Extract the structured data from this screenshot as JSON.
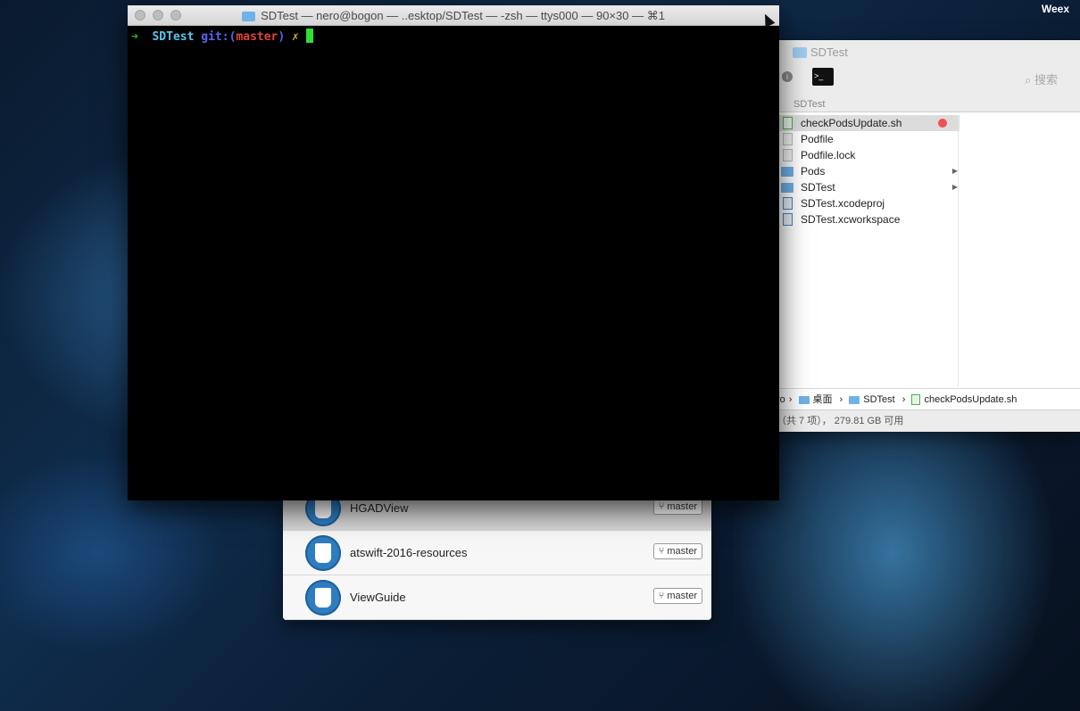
{
  "menubar": {
    "app_name": "Weex"
  },
  "github_desktop": {
    "repos": [
      {
        "name": "HGADView",
        "branch": "master",
        "selected": true
      },
      {
        "name": "atswift-2016-resources",
        "branch": "master",
        "selected": false
      },
      {
        "name": "ViewGuide",
        "branch": "master",
        "selected": false
      }
    ]
  },
  "finder": {
    "title": "SDTest",
    "search_label": "搜索",
    "path_header": "SDTest",
    "terminal_button_label": ">_",
    "files": [
      {
        "name": "checkPodsUpdate.sh",
        "kind": "script",
        "tag_color": "#ee5050",
        "selected": true
      },
      {
        "name": "Podfile",
        "kind": "file"
      },
      {
        "name": "Podfile.lock",
        "kind": "file"
      },
      {
        "name": "Pods",
        "kind": "folder"
      },
      {
        "name": "SDTest",
        "kind": "folder"
      },
      {
        "name": "SDTest.xcodeproj",
        "kind": "xcodeproj"
      },
      {
        "name": "SDTest.xcworkspace",
        "kind": "xcworkspace"
      }
    ],
    "pathbar": [
      "ro",
      "桌面",
      "SDTest",
      "checkPodsUpdate.sh"
    ],
    "status": "（共 7 项），  279.81 GB 可用"
  },
  "terminal": {
    "title": "SDTest — nero@bogon — ..esktop/SDTest — -zsh — ttys000 — 90×30 — ⌘1",
    "prompt": {
      "arrow": "➜",
      "dir": "SDTest",
      "git_label": "git:(",
      "branch": "master",
      "git_close": ")",
      "dirty_mark": "✗"
    }
  }
}
